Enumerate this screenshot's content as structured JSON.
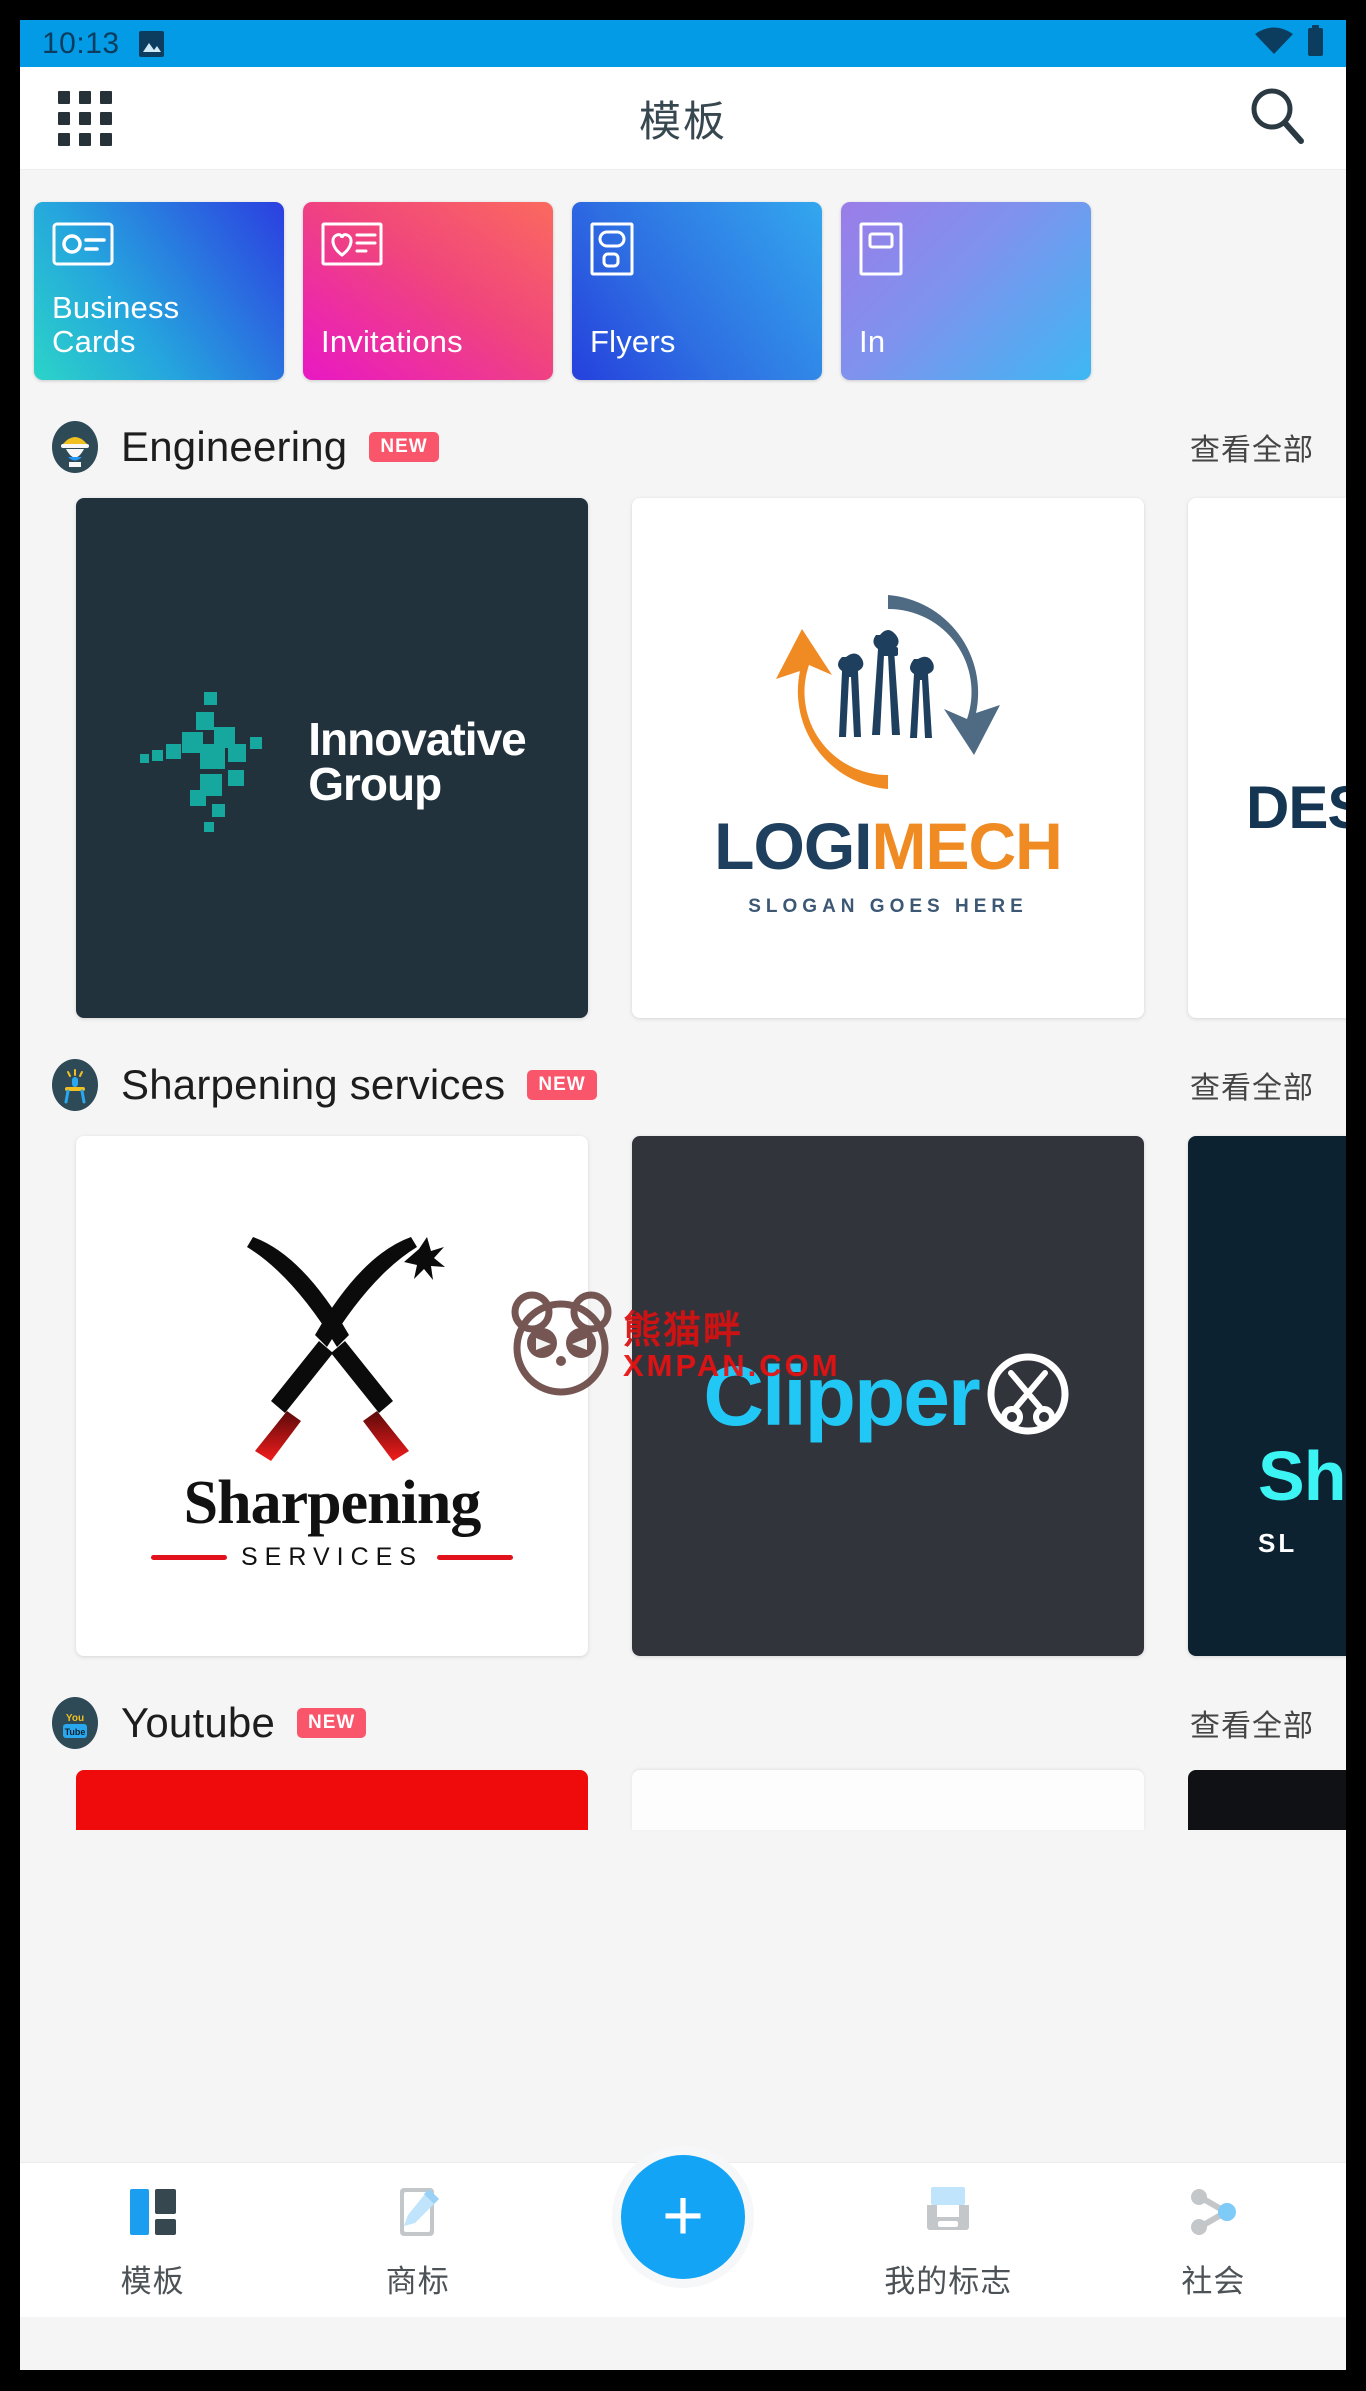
{
  "status_bar": {
    "time": "10:13",
    "image_icon": "image-icon",
    "wifi_icon": "wifi-icon",
    "battery_icon": "battery-icon",
    "background_color": "#039be5"
  },
  "app_bar": {
    "menu_icon": "grid-menu-icon",
    "title": "模板",
    "search_icon": "search-icon"
  },
  "categories": [
    {
      "label": "Business Cards",
      "icon": "business-card-icon",
      "gradient_from": "#2bd4c8",
      "gradient_to": "#2b3fe0"
    },
    {
      "label": "Invitations",
      "icon": "invitation-heart-icon",
      "gradient_from": "#e818c4",
      "gradient_to": "#fb6a5e"
    },
    {
      "label": "Flyers",
      "icon": "flyer-icon",
      "gradient_from": "#2540dd",
      "gradient_to": "#33a7ee"
    },
    {
      "label": "In",
      "icon": "infographic-icon",
      "gradient_from": "#9b7de8",
      "gradient_to": "#3eb7f3"
    }
  ],
  "sections": [
    {
      "emoji_icon": "construction-worker-icon",
      "title": "Engineering",
      "badge": "NEW",
      "see_all": "查看全部",
      "templates": [
        {
          "name": "Innovative Group",
          "line1": "Innovative",
          "line2": "Group",
          "style": "dark-navy",
          "accent": "#1ba9a4"
        },
        {
          "name": "LOGIMECH",
          "word_a": "LOGI",
          "word_b": "MECH",
          "slogan": "SLOGAN GOES HERE",
          "style": "white",
          "color_a": "#1f3f5e",
          "color_b": "#ef8b22"
        },
        {
          "name": "DESIGN partial",
          "partial_text": "DES",
          "style": "white",
          "color": "#143653"
        }
      ]
    },
    {
      "emoji_icon": "sharpening-grinder-icon",
      "title": "Sharpening services",
      "badge": "NEW",
      "see_all": "查看全部",
      "templates": [
        {
          "name": "Sharpening Services",
          "title_text": "Sharpening",
          "sub_text": "SERVICES",
          "style": "white",
          "accent": "#e2121c"
        },
        {
          "name": "Clipper",
          "title_text": "Clipper",
          "icon": "scissors-circle-icon",
          "style": "dark-gray",
          "accent": "#21c7f5"
        },
        {
          "name": "Sharp partial",
          "partial_text": "Sha",
          "partial_sub": "SL",
          "style": "dark-navy",
          "accent": "#3df4f4"
        }
      ]
    },
    {
      "emoji_icon": "youtube-icon",
      "title": "Youtube",
      "badge": "NEW",
      "see_all": "查看全部",
      "templates": [
        {
          "name": "youtube-red-card",
          "style": "red"
        },
        {
          "name": "youtube-white-card",
          "style": "white"
        },
        {
          "name": "youtube-black-card",
          "style": "black"
        }
      ]
    }
  ],
  "watermark": {
    "logo_icon": "panda-icon",
    "cn_text": "熊猫畔",
    "en_text": "XMPAN.COM",
    "color": "#e01010"
  },
  "bottom_nav": {
    "active_color": "#14a4f5",
    "items": [
      {
        "label": "模板",
        "icon": "templates-icon",
        "active": true
      },
      {
        "label": "商标",
        "icon": "logo-pen-icon",
        "active": false
      },
      {
        "label": "我的标志",
        "icon": "my-logos-icon",
        "active": false
      },
      {
        "label": "社会",
        "icon": "social-share-icon",
        "active": false
      }
    ],
    "fab": {
      "icon": "plus-icon",
      "label": "+"
    }
  }
}
